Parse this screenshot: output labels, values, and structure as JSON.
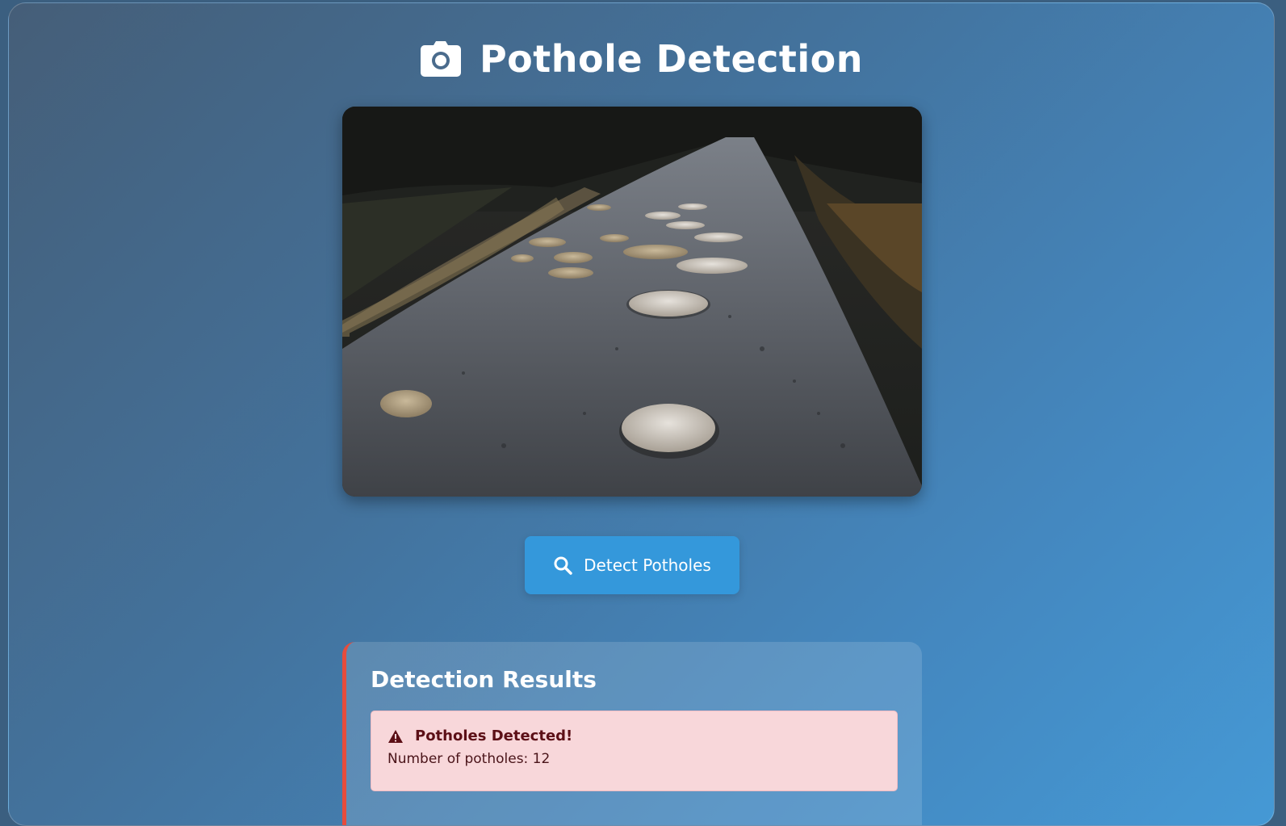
{
  "header": {
    "icon": "camera-icon",
    "title": "Pothole Detection"
  },
  "image": {
    "description_icon": "road-photo"
  },
  "actions": {
    "detect_button_label": "Detect Potholes",
    "detect_button_icon": "search-icon",
    "button_color": "#3498db"
  },
  "results": {
    "heading": "Detection Results",
    "accent_color": "#e74c3c",
    "alert": {
      "icon": "warning-icon",
      "title": "Potholes Detected!",
      "count_line": "Number of potholes: 12",
      "background": "#f8d7da"
    }
  }
}
